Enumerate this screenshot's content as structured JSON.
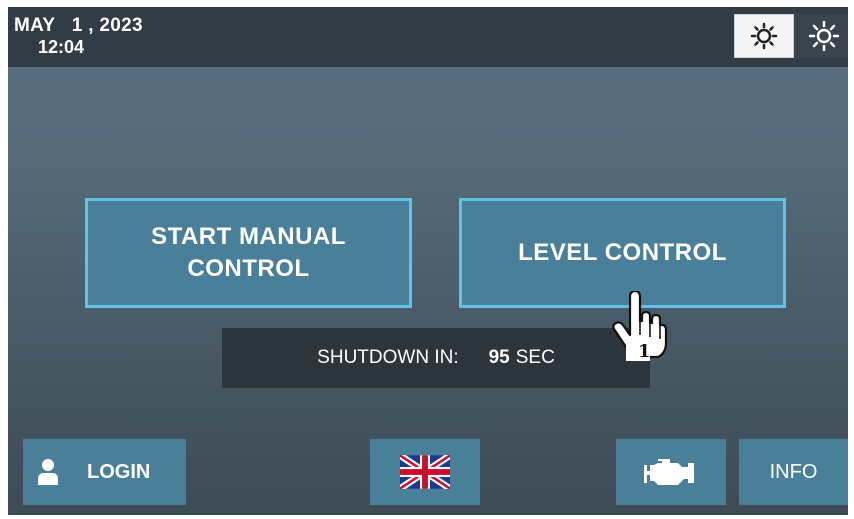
{
  "header": {
    "date": "MAY   1 , 2023",
    "time": "12:04",
    "brightness": [
      {
        "icon": "sun-outline-icon"
      },
      {
        "icon": "sun-bright-icon"
      }
    ]
  },
  "main": {
    "manual_button": "START MANUAL\nCONTROL",
    "level_button": "LEVEL CONTROL"
  },
  "shutdown": {
    "label": "SHUTDOWN IN:",
    "seconds": "95",
    "unit": "SEC"
  },
  "bottom": {
    "login_label": "LOGIN",
    "language_icon": "uk-flag-icon",
    "engine_icon": "engine-icon",
    "info_label": "INFO"
  },
  "gesture": {
    "icon": "tap-hand-icon",
    "step": "1"
  },
  "colors": {
    "button_fill": "#4a7f9a",
    "button_border": "#61c4e6",
    "header_bg": "#323c44"
  }
}
